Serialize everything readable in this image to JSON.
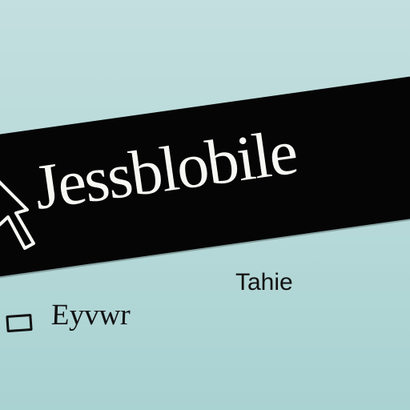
{
  "banner": {
    "title": "Jessblobile"
  },
  "secondary_label": "Tahie",
  "checkbox": {
    "label": "Eyvwr"
  },
  "colors": {
    "background": "#b6d8d8",
    "banner": "#050505",
    "banner_text": "#f7f7f3",
    "text": "#111111"
  },
  "icons": {
    "pointer": "cursor-arrow-icon"
  }
}
